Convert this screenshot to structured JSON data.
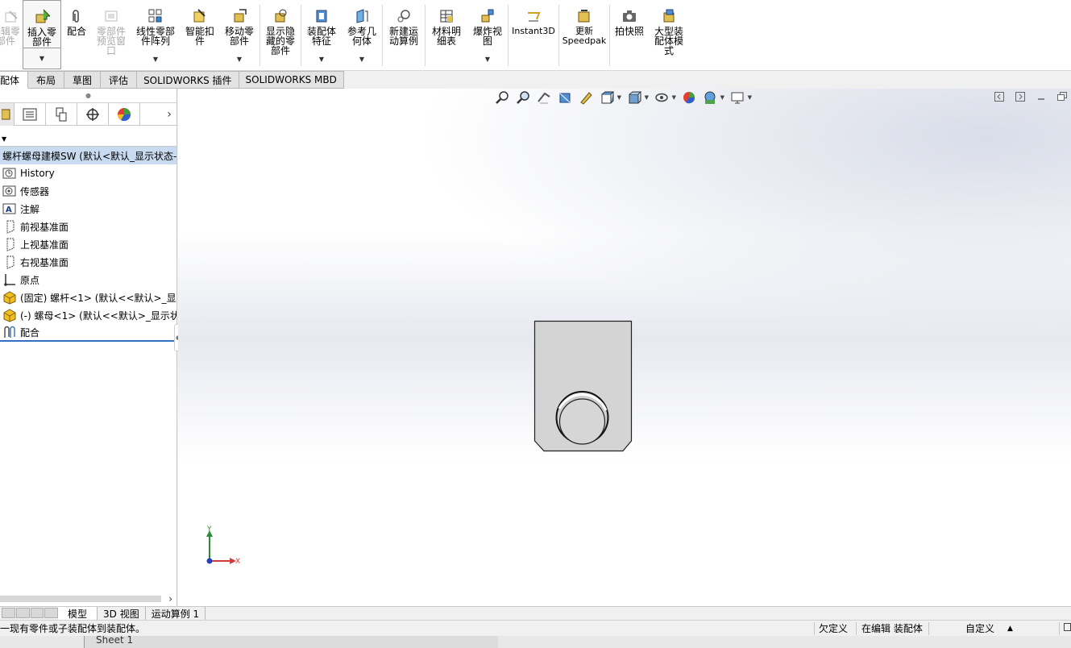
{
  "ribbon": {
    "buttons": [
      {
        "id": "edit-component",
        "label": "编辑零\n部件",
        "disabled": true
      },
      {
        "id": "insert-component",
        "label": "插入零\n部件",
        "disabled": false,
        "active": true
      },
      {
        "id": "mate",
        "label": "配合",
        "disabled": false
      },
      {
        "id": "component-preview",
        "label": "零部件\n预览窗\n口",
        "disabled": true
      },
      {
        "id": "linear-pattern",
        "label": "线性零部\n件阵列",
        "disabled": false
      },
      {
        "id": "smart-fasteners",
        "label": "智能扣\n件",
        "disabled": false
      },
      {
        "id": "move-component",
        "label": "移动零\n部件",
        "disabled": false
      },
      {
        "id": "show-hidden",
        "label": "显示隐\n藏的零\n部件",
        "disabled": false
      },
      {
        "id": "assembly-features",
        "label": "装配体\n特征",
        "disabled": false
      },
      {
        "id": "reference-geometry",
        "label": "参考几\n何体",
        "disabled": false
      },
      {
        "id": "new-motion-study",
        "label": "新建运\n动算例",
        "disabled": false
      },
      {
        "id": "bom",
        "label": "材料明\n细表",
        "disabled": false
      },
      {
        "id": "exploded-view",
        "label": "爆炸视\n图",
        "disabled": false
      },
      {
        "id": "instant3d",
        "label": "Instant3D",
        "disabled": false
      },
      {
        "id": "update-speedpak",
        "label": "更新\nSpeedpak",
        "disabled": false
      },
      {
        "id": "take-snapshot",
        "label": "拍快照",
        "disabled": false
      },
      {
        "id": "large-assembly",
        "label": "大型装\n配体模\n式",
        "disabled": false
      }
    ]
  },
  "tabs": [
    {
      "label": "配体",
      "active": true
    },
    {
      "label": "布局",
      "active": false
    },
    {
      "label": "草图",
      "active": false
    },
    {
      "label": "评估",
      "active": false
    },
    {
      "label": "SOLIDWORKS 插件",
      "active": false
    },
    {
      "label": "SOLIDWORKS MBD",
      "active": false
    }
  ],
  "tree": {
    "root": "螺杆螺母建模SW  (默认<默认_显示状态-",
    "items": [
      {
        "label": "History",
        "icon": "history-icon"
      },
      {
        "label": "传感器",
        "icon": "sensor-icon"
      },
      {
        "label": "注解",
        "icon": "annotation-icon"
      },
      {
        "label": "前视基准面",
        "icon": "plane-icon"
      },
      {
        "label": "上视基准面",
        "icon": "plane-icon"
      },
      {
        "label": "右视基准面",
        "icon": "plane-icon"
      },
      {
        "label": "原点",
        "icon": "origin-icon"
      },
      {
        "label": "(固定) 螺杆<1> (默认<<默认>_显示",
        "icon": "part-icon"
      },
      {
        "label": "(-) 螺母<1> (默认<<默认>_显示状",
        "icon": "part-icon"
      },
      {
        "label": "配合",
        "icon": "mates-icon"
      }
    ]
  },
  "triad": {
    "y": "Y",
    "x": "X"
  },
  "bottom_tabs": [
    {
      "label": "模型",
      "active": true
    },
    {
      "label": "3D 视图",
      "active": false
    },
    {
      "label": "运动算例 1",
      "active": false
    }
  ],
  "status": {
    "message": "一现有零件或子装配体到装配体。",
    "under_defined": "欠定义",
    "editing": "在编辑 装配体",
    "custom": "自定义",
    "custom_arrow": "▲"
  },
  "sheet": {
    "label": "Sheet 1"
  },
  "colors": {
    "selection": "#c9dbf1",
    "accent": "#3070c0",
    "model_face": "#d4d4d4"
  }
}
